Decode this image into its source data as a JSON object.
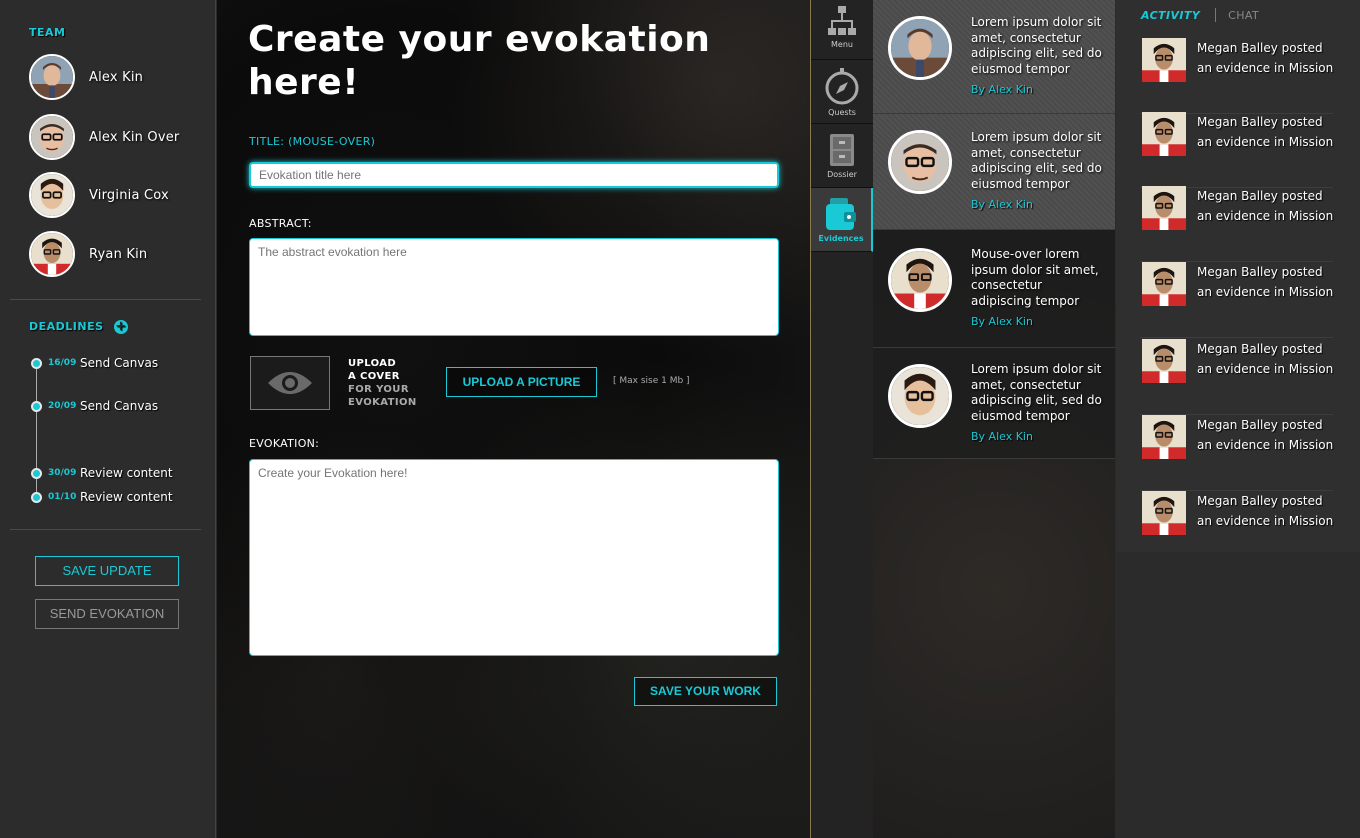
{
  "team": {
    "title": "TEAM",
    "members": [
      {
        "name": "Alex Kin"
      },
      {
        "name": "Alex Kin Over"
      },
      {
        "name": "Virginia Cox"
      },
      {
        "name": "Ryan Kin"
      }
    ]
  },
  "deadlines": {
    "title": "DEADLINES",
    "items": [
      {
        "date": "16/09",
        "task": "Send Canvas"
      },
      {
        "date": "20/09",
        "task": "Send Canvas"
      },
      {
        "date": "30/09",
        "task": "Review content"
      },
      {
        "date": "01/10",
        "task": "Review content"
      }
    ]
  },
  "actions": {
    "save_update": "SAVE UPDATE",
    "send_evokation": "SEND EVOKATION"
  },
  "form": {
    "heading": "Create your evokation here!",
    "title_label": "TITLE: (MOUSE-OVER)",
    "title_placeholder": "Evokation title here",
    "abstract_label": "ABSTRACT:",
    "abstract_placeholder": "The abstract evokation here",
    "cover_line1": "UPLOAD",
    "cover_line2": "A COVER",
    "cover_line3": "FOR YOUR",
    "cover_line4": "EVOKATION",
    "upload_button": "UPLOAD A PICTURE",
    "max_size": "[ Max sise 1 Mb ]",
    "evokation_label": "EVOKATION:",
    "evokation_placeholder": "Create your Evokation here!",
    "save_work": "SAVE YOUR WORK"
  },
  "nav": {
    "items": [
      {
        "label": "Menu",
        "icon": "hierarchy-icon"
      },
      {
        "label": "Quests",
        "icon": "compass-icon"
      },
      {
        "label": "Dossier",
        "icon": "cabinet-icon"
      },
      {
        "label": "Evidences",
        "icon": "wallet-icon",
        "active": true
      }
    ]
  },
  "evidences": [
    {
      "text": "Lorem ipsum dolor sit amet, consectetur adipiscing elit, sed do eiusmod tempor",
      "by": "By Alex Kin"
    },
    {
      "text": "Lorem ipsum dolor sit amet, consectetur adipiscing elit, sed do eiusmod tempor",
      "by": "By Alex Kin"
    },
    {
      "text": "Mouse-over lorem ipsum dolor sit amet, consectetur adipiscing tempor",
      "by": "By Alex Kin"
    },
    {
      "text": "Lorem ipsum dolor sit amet, consectetur adipiscing elit, sed do eiusmod tempor",
      "by": "By Alex Kin"
    }
  ],
  "activity": {
    "tab_activity": "ACTIVITY",
    "tab_chat": "CHAT",
    "items": [
      {
        "text": "Megan Balley posted an evidence in Mission"
      },
      {
        "text": "Megan Balley posted an evidence in Mission"
      },
      {
        "text": "Megan Balley posted an evidence in Mission"
      },
      {
        "text": "Megan Balley posted an evidence in Mission"
      },
      {
        "text": "Megan Balley posted an evidence in Mission"
      },
      {
        "text": "Megan Balley posted an evidence in Mission"
      },
      {
        "text": "Megan Balley posted an evidence in Mission"
      }
    ]
  },
  "colors": {
    "accent": "#19c9d6",
    "background": "#2c2c2c"
  }
}
